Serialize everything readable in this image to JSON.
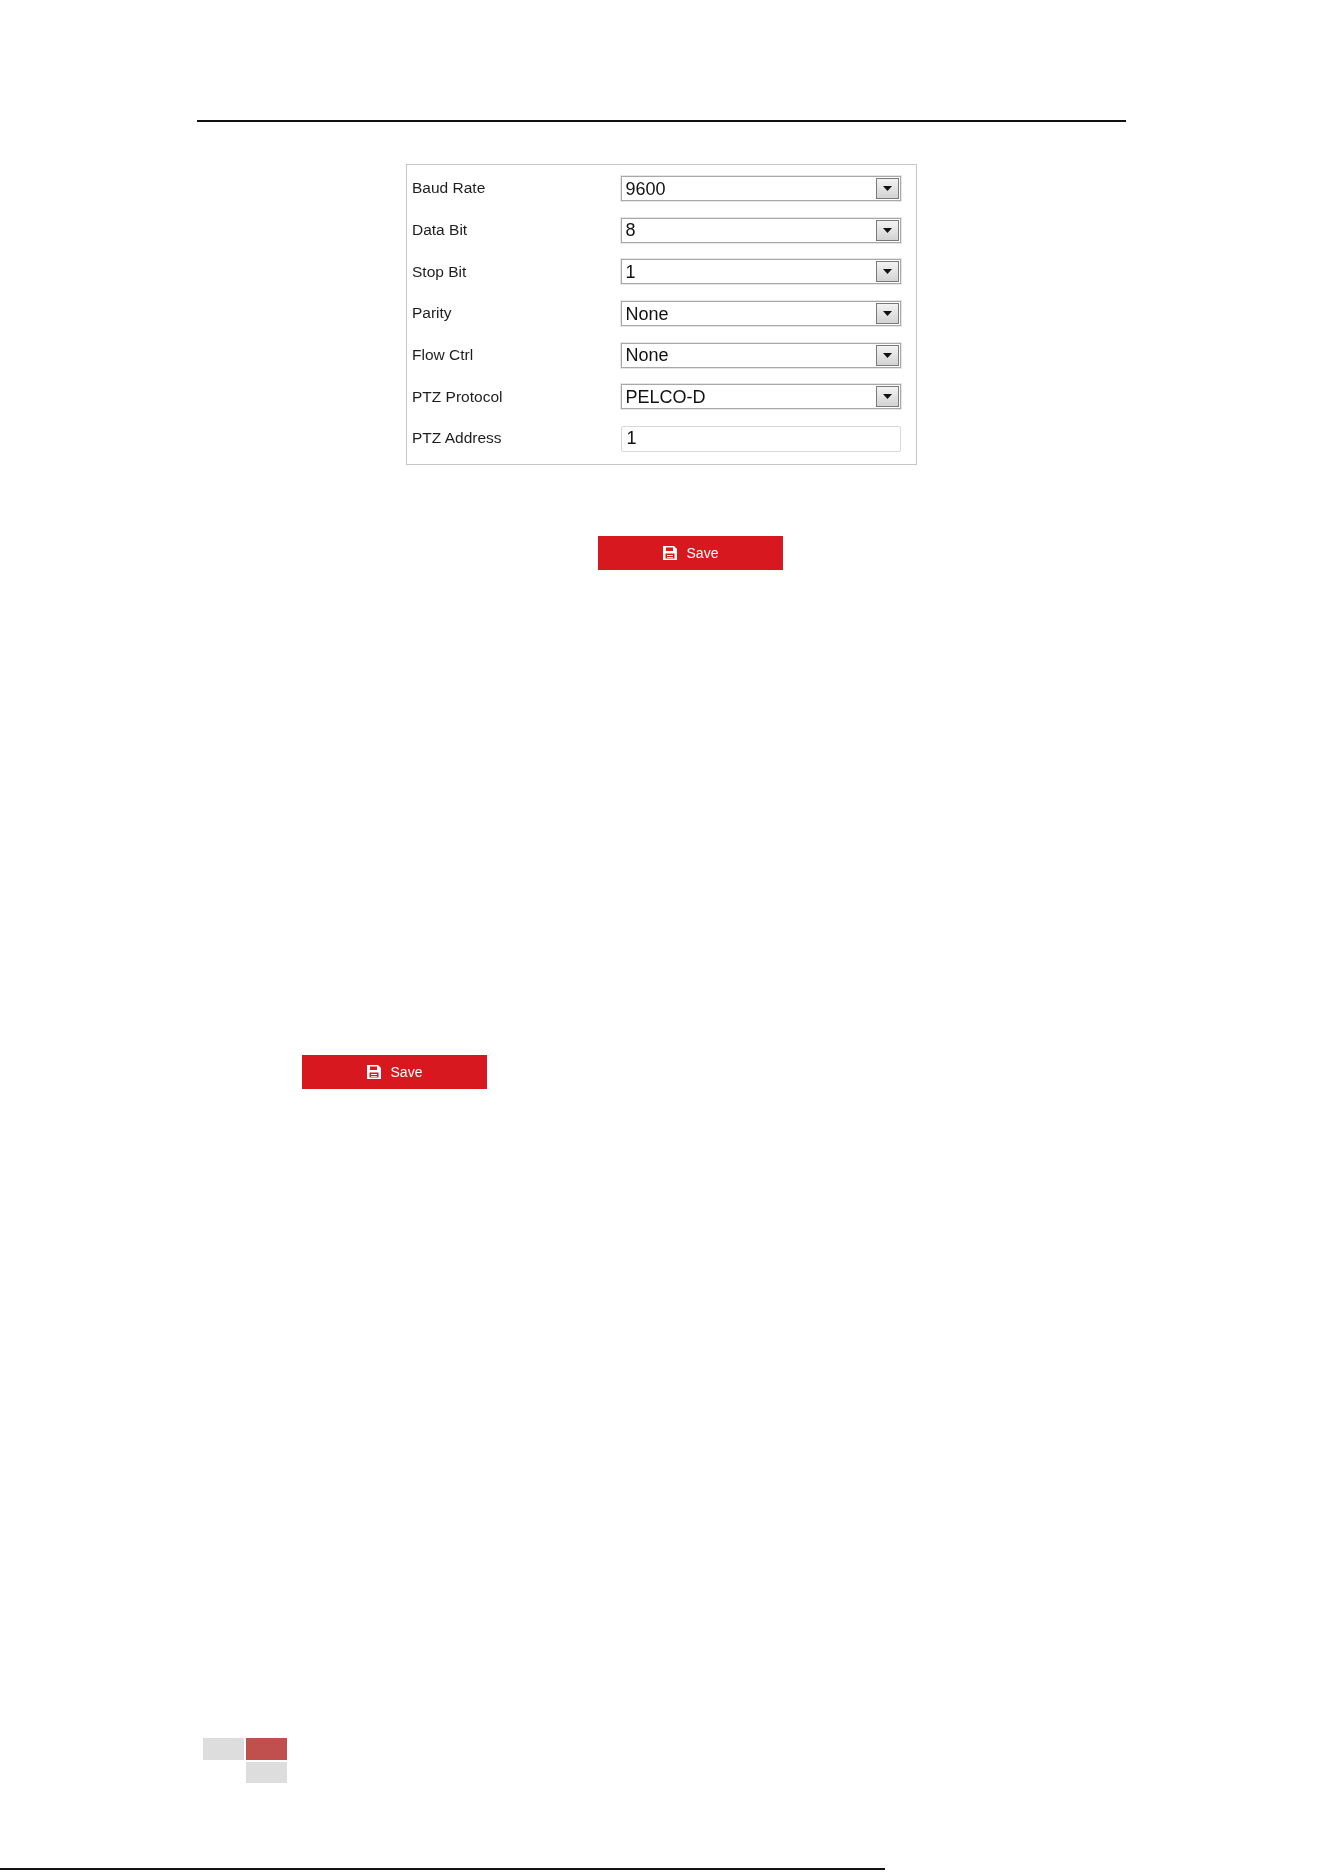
{
  "settings_panel": {
    "fields": [
      {
        "kind": "select",
        "label": "Baud Rate",
        "value": "9600"
      },
      {
        "kind": "select",
        "label": "Data Bit",
        "value": "8"
      },
      {
        "kind": "select",
        "label": "Stop Bit",
        "value": "1"
      },
      {
        "kind": "select",
        "label": "Parity",
        "value": "None"
      },
      {
        "kind": "select",
        "label": "Flow Ctrl",
        "value": "None"
      },
      {
        "kind": "select",
        "label": "PTZ Protocol",
        "value": "PELCO-D"
      },
      {
        "kind": "text",
        "label": "PTZ Address",
        "value": "1"
      }
    ]
  },
  "save_buttons": [
    {
      "label": "Save"
    },
    {
      "label": "Save"
    }
  ]
}
